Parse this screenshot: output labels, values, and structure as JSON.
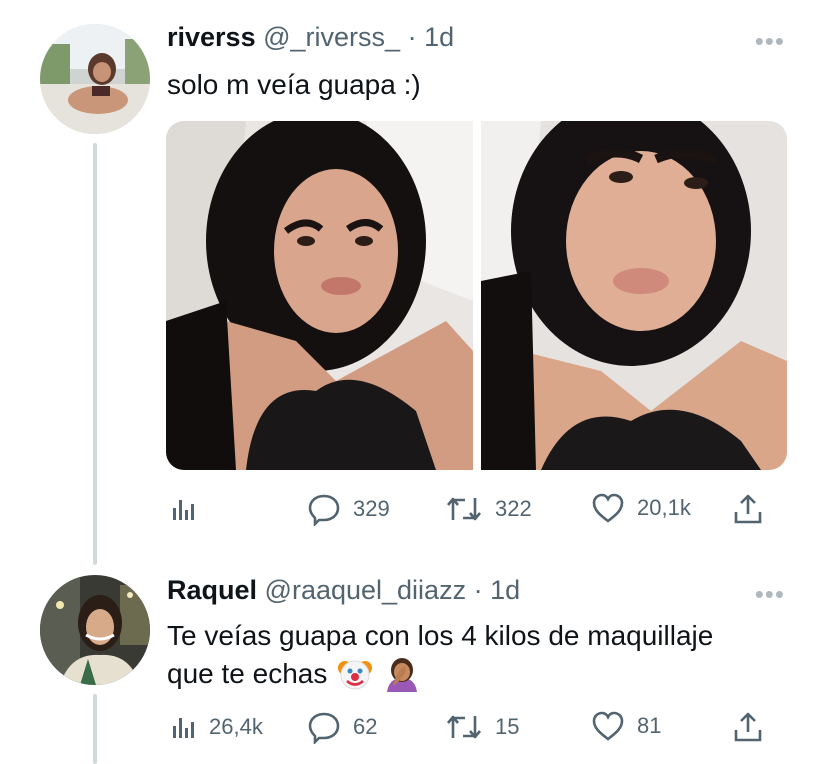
{
  "tweets": [
    {
      "name": "riverss",
      "handle": "@_riverss_",
      "time": "· 1d",
      "text": "solo m veía guapa :)",
      "more": "•••",
      "actions": {
        "replies": "329",
        "retweets": "322",
        "likes": "20,1k"
      }
    },
    {
      "name": "Raquel",
      "handle": "@raaquel_diiazz",
      "time": "· 1d",
      "text_line1": "Te veías guapa con los 4 kilos de maquillaje",
      "text_line2": "que te echas",
      "emojis": [
        "clown-face",
        "facepalm"
      ],
      "more": "•••",
      "actions": {
        "views": "26,4k",
        "replies": "62",
        "retweets": "15",
        "likes": "81"
      }
    }
  ],
  "icons": {
    "views": "bar-chart-icon",
    "reply": "speech-bubble-icon",
    "retweet": "retweet-arrows-icon",
    "like": "heart-icon",
    "share": "share-upload-icon"
  },
  "colors": {
    "text": "#0f1419",
    "secondary": "#536471",
    "thread_line": "#cfd9de"
  }
}
